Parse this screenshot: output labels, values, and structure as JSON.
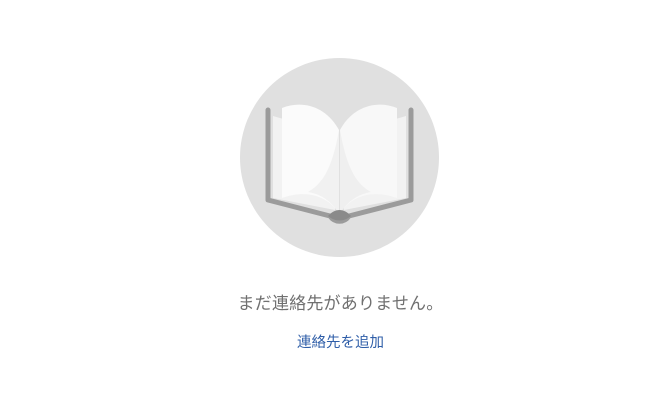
{
  "empty_state": {
    "icon": "open-book-icon",
    "message": "まだ連絡先がありません。",
    "add_link_label": "連絡先を追加"
  },
  "colors": {
    "circle_background": "#e0e0e0",
    "message_text": "#707070",
    "link_text": "#2f5ea8"
  }
}
